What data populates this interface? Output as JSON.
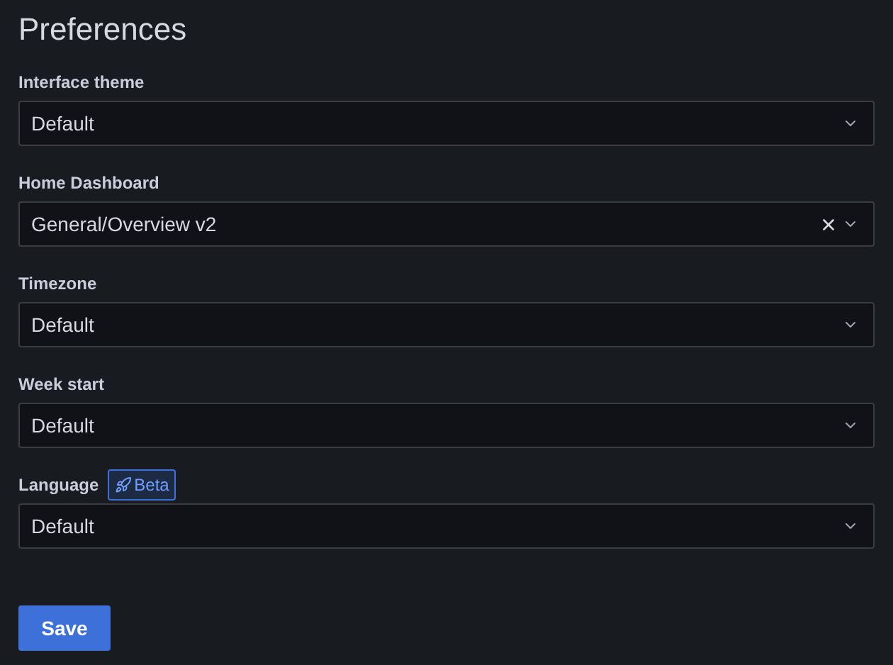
{
  "title": "Preferences",
  "fields": [
    {
      "label": "Interface theme",
      "value": "Default",
      "clearable": false
    },
    {
      "label": "Home Dashboard",
      "value": "General/Overview v2",
      "clearable": true
    },
    {
      "label": "Timezone",
      "value": "Default",
      "clearable": false
    },
    {
      "label": "Week start",
      "value": "Default",
      "clearable": false
    },
    {
      "label": "Language",
      "badge": "Beta",
      "value": "Default",
      "clearable": false
    }
  ],
  "save_button": "Save"
}
